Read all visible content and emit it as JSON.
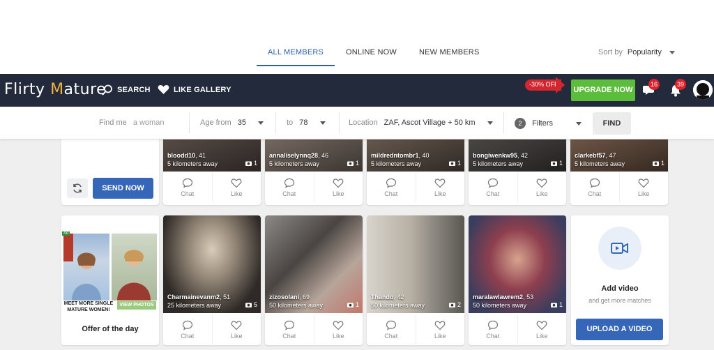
{
  "tabs": [
    {
      "label": "ALL MEMBERS",
      "active": true
    },
    {
      "label": "ONLINE NOW",
      "active": false
    },
    {
      "label": "NEW MEMBERS",
      "active": false
    }
  ],
  "sort": {
    "label": "Sort by",
    "value": "Popularity"
  },
  "nav": {
    "logo_part1": "Flirty ",
    "logo_part2": "M",
    "logo_part3": "ature",
    "search": "SEARCH",
    "like_gallery": "LIKE GALLERY",
    "discount": "-30% OFF",
    "upgrade": "UPGRADE NOW",
    "messages_count": "16",
    "notifications_count": "39"
  },
  "filters": {
    "find_me_label": "Find me",
    "find_me_value": "a woman",
    "age_from_label": "Age from",
    "age_from_value": "35",
    "age_to_label": "to",
    "age_to_value": "78",
    "location_label": "Location",
    "location_value": "ZAF, Ascot Village + 50 km",
    "filters_count": "2",
    "filters_label": "Filters",
    "find_button": "FIND"
  },
  "row1": [
    {
      "name": "bloodd10",
      "age": "41",
      "distance": "5 kilometers away",
      "photos": "1"
    },
    {
      "name": "annaliselynnq28",
      "age": "46",
      "distance": "5 kilometers away",
      "photos": "1"
    },
    {
      "name": "mildredntombr1",
      "age": "40",
      "distance": "5 kilometers away",
      "photos": "1"
    },
    {
      "name": "bongiwenkw95",
      "age": "42",
      "distance": "5 kilometers away",
      "photos": "1"
    },
    {
      "name": "clarkebf57",
      "age": "47",
      "distance": "5 kilometers away",
      "photos": "1"
    }
  ],
  "row2": [
    {
      "name": "Charmainevanm2",
      "age": "51",
      "distance": "25 kilometers away",
      "photos": "5"
    },
    {
      "name": "zizosolani",
      "age": "69",
      "distance": "50 kilometers away",
      "photos": "1"
    },
    {
      "name": "Thando",
      "age": "42",
      "distance": "50 kilometers away",
      "photos": "2"
    },
    {
      "name": "maralawlawrem2",
      "age": "53",
      "distance": "50 kilometers away",
      "photos": "1"
    }
  ],
  "actions": {
    "chat": "Chat",
    "like": "Like"
  },
  "send_now": "SEND NOW",
  "offer": {
    "ad_badge": "Ad",
    "caption": "MEET MORE SINGLE MATURE WOMEN!",
    "view_photos": "VIEW PHOTOS",
    "label": "Offer of the day"
  },
  "video": {
    "title": "Add video",
    "subtitle": "and get more matches",
    "upload_button": "UPLOAD A VIDEO"
  },
  "colors": {
    "navbar": "#232a3b",
    "accent_blue": "#3566b8",
    "upgrade_green": "#5cbd3b",
    "badge_red": "#e0202a"
  }
}
